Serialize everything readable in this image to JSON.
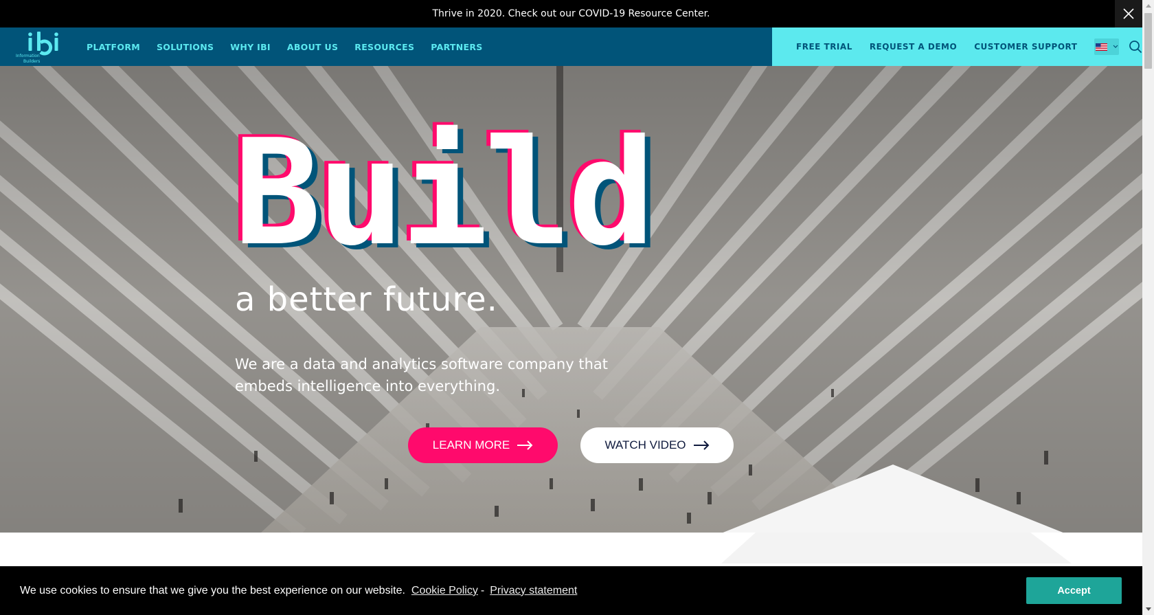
{
  "announcement": {
    "text": "Thrive in 2020. Check out our COVID-19 Resource Center.",
    "close_icon": "close-icon"
  },
  "header": {
    "logo": {
      "wordmark": "ibi",
      "line1": "Information",
      "line2": "Builders"
    },
    "nav": [
      {
        "label": "PLATFORM"
      },
      {
        "label": "SOLUTIONS"
      },
      {
        "label": "WHY IBI"
      },
      {
        "label": "ABOUT US"
      },
      {
        "label": "RESOURCES"
      },
      {
        "label": "PARTNERS"
      }
    ],
    "utility_links": [
      {
        "label": "FREE TRIAL"
      },
      {
        "label": "REQUEST A DEMO"
      },
      {
        "label": "CUSTOMER SUPPORT"
      }
    ],
    "language": {
      "flag": "us-flag-icon",
      "chevron": "chevron-down-icon"
    },
    "search_icon": "search-icon"
  },
  "hero": {
    "headline": "Build",
    "subheadline": "a better future.",
    "description": "We are a data and analytics software company that embeds intelligence into everything.",
    "buttons": {
      "learn_more": "LEARN MORE",
      "watch_video": "WATCH VIDEO"
    }
  },
  "cookie_bar": {
    "message": "We use cookies to ensure that we give you the best experience on our website.",
    "cookie_policy_link": "Cookie Policy",
    "separator": "-",
    "privacy_link": "Privacy statement",
    "accept_label": "Accept"
  },
  "colors": {
    "header_bg": "#015479",
    "accent_cyan": "#5ce9ee",
    "accent_pink": "#ff0a6c",
    "accept_teal": "#1ea599",
    "announce_bg": "#000000"
  }
}
